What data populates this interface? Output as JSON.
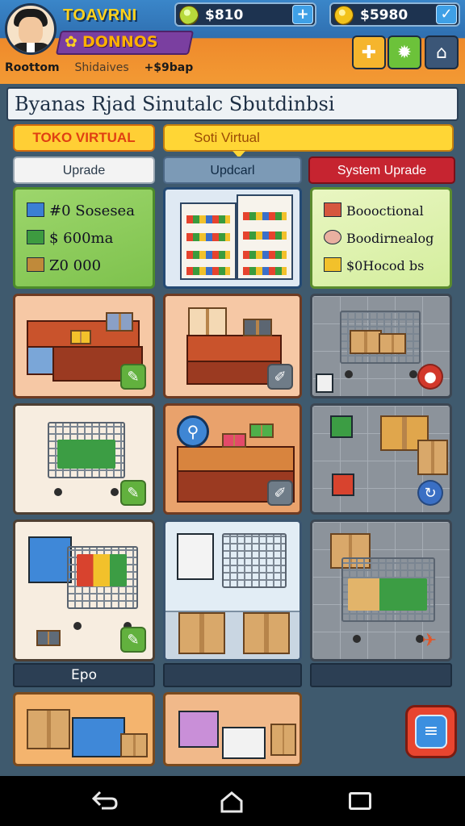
{
  "header": {
    "title_top": "TOAVRNI",
    "title_bottom": "DONNOS",
    "stat_items": [
      "Roottom",
      "Shidaives",
      "+$9bap"
    ],
    "currency": [
      {
        "icon": "green-gem-coin-icon",
        "value": "$810",
        "button": "+"
      },
      {
        "icon": "gold-coin-icon",
        "value": "$5980",
        "button": "✓"
      }
    ],
    "tool_icons": [
      "puzzle-icon",
      "gear-icon",
      "shop-icon"
    ]
  },
  "subtitle": "Byanas Rjad Sinutalc Sbutdinbsi",
  "tabs": {
    "main": [
      "TOKO VIRTUAL",
      "Soti Virtual"
    ],
    "sub": [
      "Uprade",
      "Updcarl",
      "System Uprade"
    ]
  },
  "cards": {
    "stats_left": [
      "#0 Sosesea",
      "$ 600ma",
      "Z0 000"
    ],
    "stats_right": [
      "Boooctional",
      "Boodirnealog",
      "$0Hocod bs"
    ]
  },
  "labels": {
    "epo": "Epo"
  },
  "colors": {
    "accent_orange": "#f39a34",
    "accent_blue": "#2f6fb0",
    "danger_red": "#c62430",
    "success_green": "#62b13e"
  }
}
